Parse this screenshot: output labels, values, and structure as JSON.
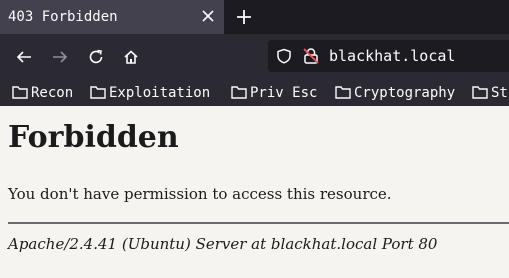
{
  "browser": {
    "tab": {
      "title": "403 Forbidden",
      "close_icon": "close-icon"
    },
    "new_tab_icon": "plus-icon",
    "nav": {
      "back_icon": "arrow-left-icon",
      "forward_icon": "arrow-right-icon",
      "reload_icon": "reload-icon",
      "home_icon": "home-icon"
    },
    "urlbar": {
      "url": "blackhat.local",
      "tracking_icon": "shield-icon",
      "security_icon": "insecure-lock-icon"
    },
    "bookmarks": [
      {
        "label": "Recon"
      },
      {
        "label": "Exploitation"
      },
      {
        "label": "Priv Esc"
      },
      {
        "label": "Cryptography"
      },
      {
        "label": "St"
      }
    ]
  },
  "page": {
    "title": "Forbidden",
    "message": "You don't have permission to access this resource.",
    "address": "Apache/2.4.41 (Ubuntu) Server at blackhat.local Port 80"
  },
  "colors": {
    "chrome_dark": "#1c1b22",
    "toolbar": "#2b2a33",
    "tab_active": "#42414d",
    "page_background": "#f6f4f1",
    "text": "#1b1b1b"
  }
}
